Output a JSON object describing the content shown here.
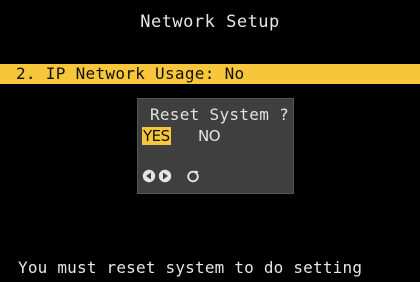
{
  "header": {
    "title": "Network Setup"
  },
  "menu": {
    "selected_item": "2. IP Network Usage: No"
  },
  "dialog": {
    "title": "Reset System ?",
    "options": {
      "yes": "YES",
      "no": "NO"
    },
    "icons": [
      "left-arrow-icon",
      "right-arrow-icon",
      "confirm-icon"
    ]
  },
  "footer": {
    "message": "You must reset system to do setting"
  },
  "colors": {
    "highlight": "#f7c63a",
    "background": "#000000",
    "dialog_bg": "#3f3f3f",
    "text": "#e6e6e6"
  }
}
